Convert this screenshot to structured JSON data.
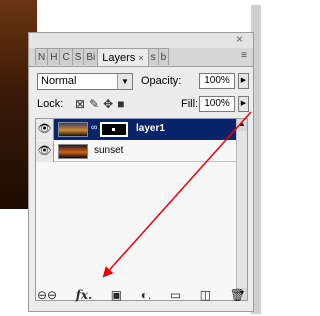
{
  "panel": {
    "tabs": [
      "N",
      "H",
      "C",
      "S",
      "Bi",
      "Layers"
    ],
    "active_tab_index": 5,
    "active_tab_close": "×",
    "collapsed_tabs": [
      "s",
      "b"
    ],
    "close_glyph": "×",
    "menu_glyph": "≡"
  },
  "controls": {
    "blend_mode": "Normal",
    "opacity_label": "Opacity:",
    "opacity_value": "100%",
    "lock_label": "Lock:",
    "fill_label": "Fill:",
    "fill_value": "100%"
  },
  "layers": [
    {
      "name": "layer1",
      "selected": true,
      "visible": true
    },
    {
      "name": "sunset",
      "selected": false,
      "visible": true
    }
  ],
  "bottom_icons": [
    "link-layers",
    "fx",
    "add-mask",
    "adjustment-layer",
    "new-group",
    "new-layer",
    "delete-layer"
  ],
  "colors": {
    "selected_row": "#0a246a",
    "arrow": "#e8000c"
  }
}
